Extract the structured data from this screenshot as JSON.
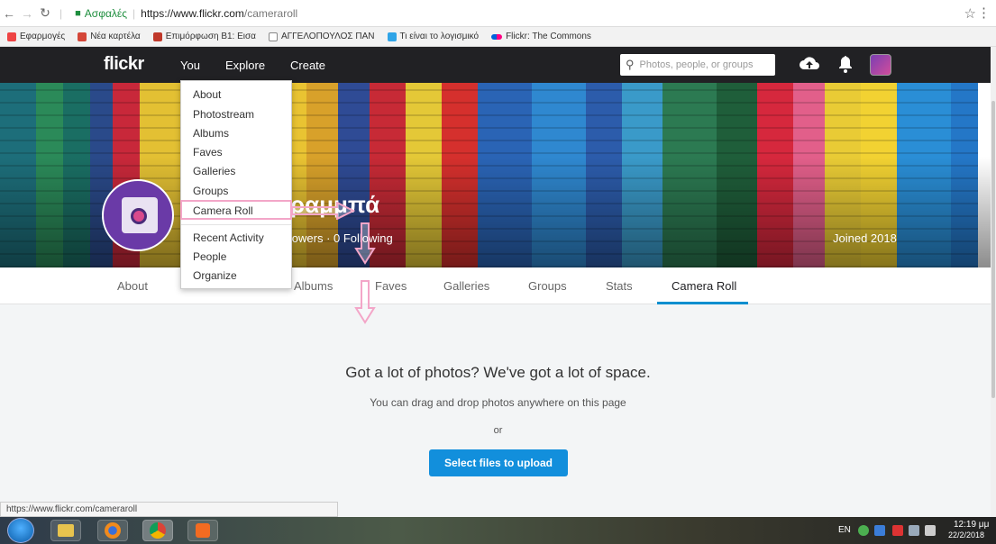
{
  "browser": {
    "secure_label": "Ασφαλές",
    "url_host": "https://www.flickr.com",
    "url_path": "/cameraroll",
    "bookmarks": [
      {
        "label": "Εφαρμογές",
        "color": "#e44"
      },
      {
        "label": "Νέα καρτέλα",
        "color": "#d44638"
      },
      {
        "label": "Επιμόρφωση Β1: Εισα",
        "color": "#c0392b"
      },
      {
        "label": "ΑΓΓΕΛΟΠΟΥΛΟΣ ΠΑΝ",
        "color": "#888"
      },
      {
        "label": "Τι είναι το λογισμικό",
        "color": "#2fa4e7"
      },
      {
        "label": "Flickr: The Commons",
        "color": "#ff0084"
      }
    ],
    "status_url": "https://www.flickr.com/cameraroll"
  },
  "flickr_nav": {
    "logo": "flickr",
    "you": "You",
    "explore": "Explore",
    "create": "Create",
    "search_placeholder": "Photos, people, or groups"
  },
  "dropdown": {
    "items": [
      "About",
      "Photostream",
      "Albums",
      "Faves",
      "Galleries",
      "Groups",
      "Camera Roll",
      "Recent Activity",
      "People",
      "Organize"
    ]
  },
  "profile": {
    "name_suffix": "ραμμπά",
    "stats": "llowers  ·  0 Following",
    "joined": "Joined 2018"
  },
  "subnav": {
    "tabs": [
      "About",
      "Albums",
      "Faves",
      "Galleries",
      "Groups",
      "Stats",
      "Camera Roll"
    ],
    "active": "Camera Roll"
  },
  "main": {
    "headline": "Got a lot of photos? We've got a lot of space.",
    "sub": "You can drag and drop photos anywhere on this page",
    "or": "or",
    "upload_button": "Select files to upload"
  },
  "taskbar": {
    "lang": "EN",
    "time": "12:19 μμ",
    "date": "22/2/2018"
  },
  "colors": {
    "flickr_dark": "#212124",
    "accent_blue": "#128fdc",
    "tab_underline": "#008ecf",
    "annotation_pink": "#f3a6c8"
  }
}
